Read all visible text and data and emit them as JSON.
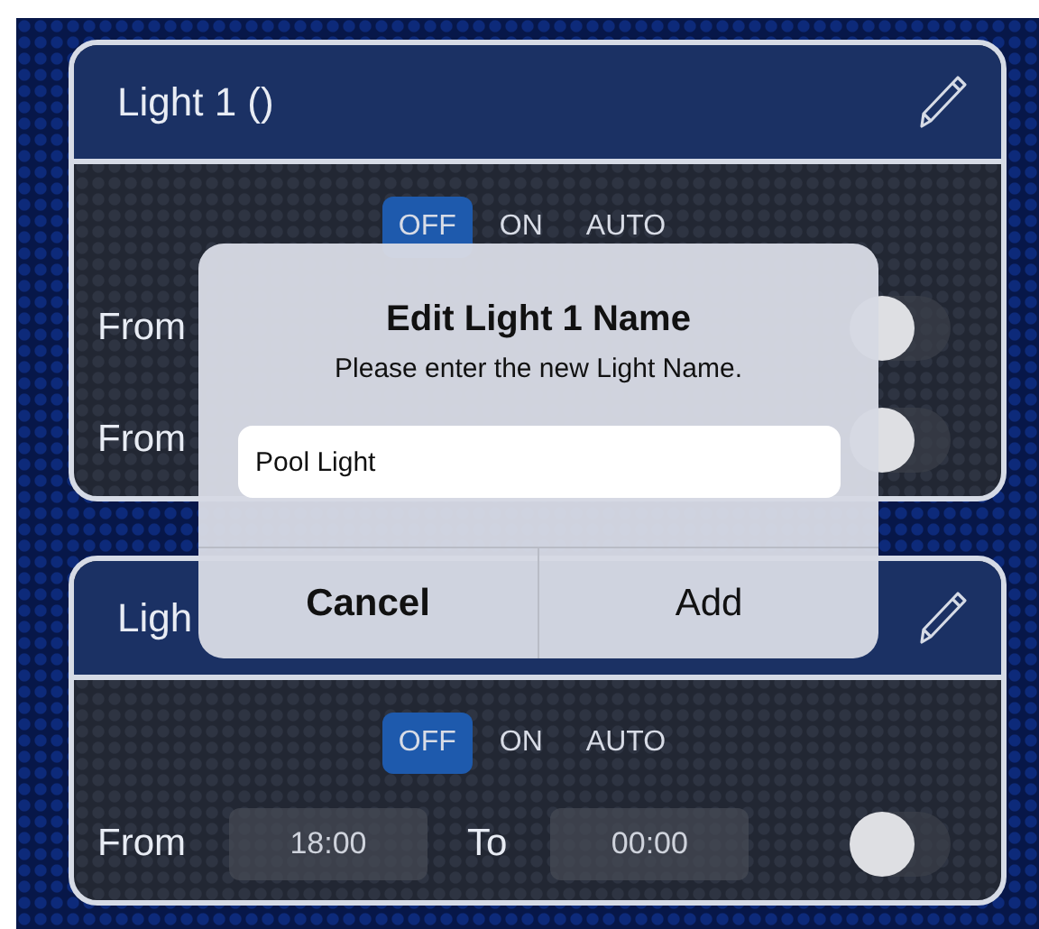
{
  "cards": [
    {
      "title": "Light 1 ()",
      "modes": [
        {
          "label": "OFF",
          "selected": true
        },
        {
          "label": "ON",
          "selected": false
        },
        {
          "label": "AUTO",
          "selected": false
        }
      ],
      "schedules": [
        {
          "from_label": "From",
          "on": false
        },
        {
          "from_label": "From",
          "on": false
        }
      ]
    },
    {
      "title": "Ligh",
      "modes": [
        {
          "label": "OFF",
          "selected": true
        },
        {
          "label": "ON",
          "selected": false
        },
        {
          "label": "AUTO",
          "selected": false
        }
      ],
      "schedules": [
        {
          "from_label": "From",
          "from_time": "18:00",
          "to_label": "To",
          "to_time": "00:00",
          "on": false
        }
      ]
    }
  ],
  "dialog": {
    "title": "Edit Light 1 Name",
    "message": "Please enter the new Light Name.",
    "value": "Pool Light",
    "buttons": [
      {
        "label": "Cancel",
        "kind": "cancel"
      },
      {
        "label": "Add",
        "kind": "default"
      }
    ]
  }
}
